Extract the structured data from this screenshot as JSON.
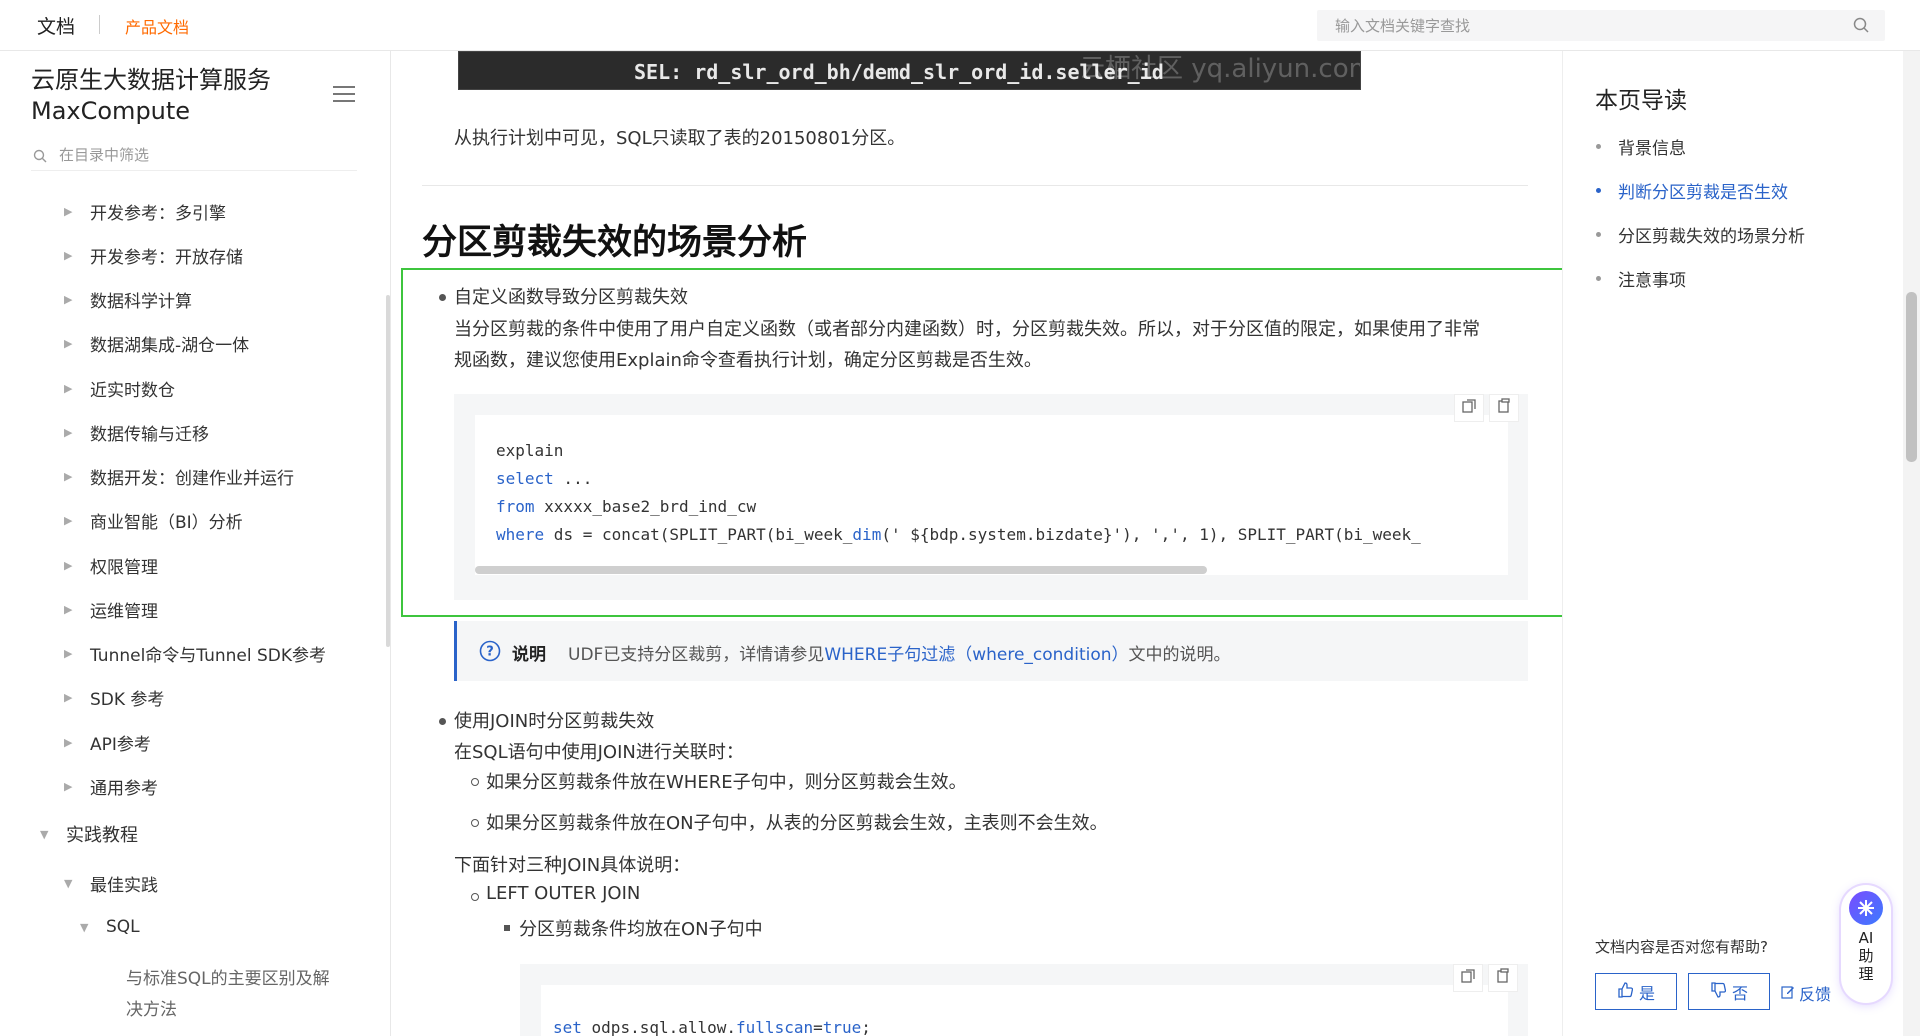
{
  "topbar": {
    "brand": "文档",
    "product": "产品文档",
    "search_placeholder": "输入文档关键字查找"
  },
  "sidebar": {
    "title_line1": "云原生大数据计算服务",
    "title_line2": "MaxCompute",
    "filter_placeholder": "在目录中筛选",
    "items": [
      "开发参考：多引擎",
      "开发参考：开放存储",
      "数据科学计算",
      "数据湖集成-湖仓一体",
      "近实时数仓",
      "数据传输与迁移",
      "数据开发：创建作业并运行",
      "商业智能（BI）分析",
      "权限管理",
      "运维管理",
      "Tunnel命令与Tunnel SDK参考",
      "SDK 参考",
      "API参考",
      "通用参考"
    ],
    "section": "实践教程",
    "sub_section": "最佳实践",
    "sub_sub_section": "SQL",
    "leaf_line1": "与标准SQL的主要区别及解",
    "leaf_line2": "决方法"
  },
  "main": {
    "top_image_code": "SEL: rd_slr_ord_bh/demd_slr_ord_id.seller_id",
    "top_image_watermark": "云栖社区 yq.aliyun.com",
    "plan_text": "从执行计划中可见，SQL只读取了表的20150801分区。",
    "heading": "分区剪裁失效的场景分析",
    "bullet1_title": "自定义函数导致分区剪裁失效",
    "bullet1_line1": "当分区剪裁的条件中使用了用户自定义函数（或者部分内建函数）时，分区剪裁失效。所以，对于分区值的限定，如果使用了非常",
    "bullet1_line2": "规函数，建议您使用Explain命令查看执行计划，确定分区剪裁是否生效。",
    "code1": {
      "line1": "explain",
      "line2_kw": "select",
      "line2_rest": " ...",
      "line3_kw": "from",
      "line3_rest": " xxxxx_base2_brd_ind_cw",
      "line4_kw": "where",
      "line4_a": " ds = concat(SPLIT_PART(bi_week_",
      "line4_fn": "dim",
      "line4_b": "(' ${bdp.system.bizdate}'), ',', 1), SPLIT_PART(bi_week_"
    },
    "note_label": "说明",
    "note_prefix": "UDF已支持分区裁剪，详情请参见",
    "note_link": "WHERE子句过滤（where_condition）",
    "note_suffix": "文中的说明。",
    "bullet2_title": "使用JOIN时分区剪裁失效",
    "bullet2_intro": "在SQL语句中使用JOIN进行关联时：",
    "bullet2_sub1": "如果分区剪裁条件放在WHERE子句中，则分区剪裁会生效。",
    "bullet2_sub2": "如果分区剪裁条件放在ON子句中，从表的分区剪裁会生效，主表则不会生效。",
    "join_intro": "下面针对三种JOIN具体说明：",
    "join_type": "LEFT OUTER JOIN",
    "join_sub": "分区剪裁条件均放在ON子句中",
    "code2": {
      "kw": "set",
      "a": " odps.sql.allow.",
      "fn": "fullscan",
      "b": "=",
      "val": "true",
      "c": ";"
    }
  },
  "toc": {
    "title": "本页导读",
    "items": [
      "背景信息",
      "判断分区剪裁是否生效",
      "分区剪裁失效的场景分析",
      "注意事项"
    ],
    "active_index": 1,
    "feedback_question": "文档内容是否对您有帮助?",
    "yes": "是",
    "no": "否",
    "feedback_link": "反馈"
  },
  "ai_assistant": {
    "label_1": "AI",
    "label_2": "助",
    "label_3": "理"
  },
  "colors": {
    "accent": "#2a63c9",
    "brand": "#ff6a00",
    "highlight": "#3ec53e"
  }
}
